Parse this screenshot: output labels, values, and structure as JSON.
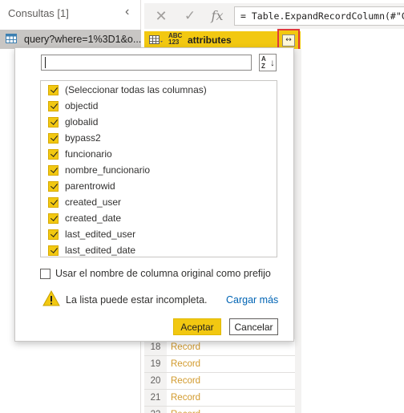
{
  "queries": {
    "header": "Consultas [1]",
    "collapse_icon": "chevron-left-icon",
    "items": [
      {
        "label": "query?where=1%3D1&o...",
        "icon": "table-icon"
      }
    ]
  },
  "formula_bar": {
    "cancel_icon": "close-icon",
    "accept_icon": "check-icon",
    "fx_label": "fx",
    "formula": "= Table.ExpandRecordColumn(#\"C"
  },
  "column_header": {
    "type_label_top": "ABC",
    "type_label_bottom": "123",
    "name": "attributes",
    "expand_icon": "expand-column-icon"
  },
  "grid_rows": [
    {
      "num": "18",
      "value": "Record"
    },
    {
      "num": "19",
      "value": "Record"
    },
    {
      "num": "20",
      "value": "Record"
    },
    {
      "num": "21",
      "value": "Record"
    },
    {
      "num": "22",
      "value": "Record"
    }
  ],
  "popup": {
    "search": {
      "value": "",
      "placeholder": ""
    },
    "sort_icon": "sort-az-icon",
    "columns": [
      {
        "label": "(Seleccionar todas las columnas)",
        "checked": true
      },
      {
        "label": "objectid",
        "checked": true
      },
      {
        "label": "globalid",
        "checked": true
      },
      {
        "label": "bypass2",
        "checked": true
      },
      {
        "label": "funcionario",
        "checked": true
      },
      {
        "label": "nombre_funcionario",
        "checked": true
      },
      {
        "label": "parentrowid",
        "checked": true
      },
      {
        "label": "created_user",
        "checked": true
      },
      {
        "label": "created_date",
        "checked": true
      },
      {
        "label": "last_edited_user",
        "checked": true
      },
      {
        "label": "last_edited_date",
        "checked": true
      }
    ],
    "prefix_label": "Usar el nombre de columna original como prefijo",
    "prefix_checked": false,
    "warning_icon": "warning-icon",
    "warning_text": "La lista puede estar incompleta.",
    "load_more": "Cargar más",
    "ok_label": "Aceptar",
    "cancel_label": "Cancelar"
  },
  "colors": {
    "accent": "#f2c811",
    "highlight_border": "#e03a3a",
    "link": "#0064b4",
    "record_text": "#d29a2c"
  }
}
